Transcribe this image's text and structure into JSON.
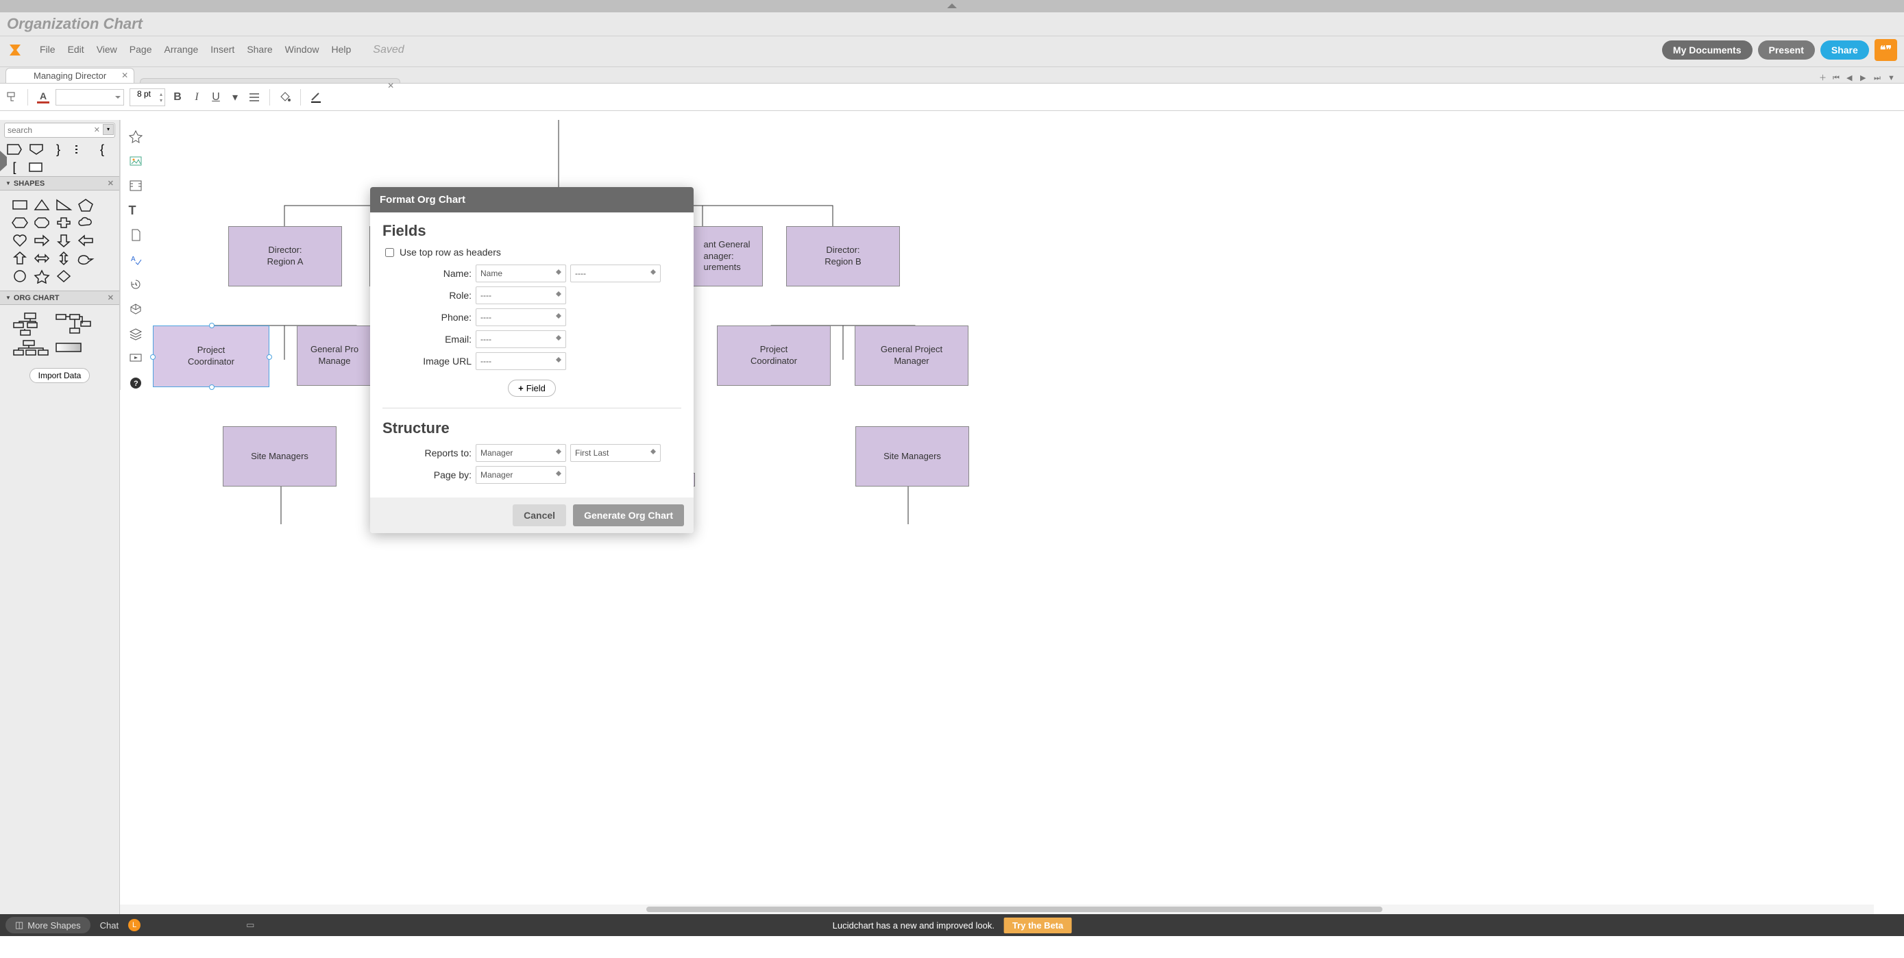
{
  "doc_title": "Organization Chart",
  "menus": [
    "File",
    "Edit",
    "View",
    "Page",
    "Arrange",
    "Insert",
    "Share",
    "Window",
    "Help"
  ],
  "saved": "Saved",
  "buttons": {
    "my_docs": "My Documents",
    "present": "Present",
    "share": "Share",
    "quote": "❝❞"
  },
  "tabs": {
    "tab1": "Managing Director",
    "tab2": ""
  },
  "toolbar": {
    "font_size": "8 pt"
  },
  "sidebar": {
    "search_placeholder": "search",
    "section_shapes": "SHAPES",
    "section_org": "ORG CHART",
    "import": "Import Data"
  },
  "chart_nodes": {
    "dir_a": "Director:\nRegion A",
    "dir_b": "Director:\nRegion B",
    "asst_gm": "ant General\nanager:\nurements",
    "pc1": "Project\nCoordinator",
    "gpm1": "General Pro\nManage",
    "pc2": "Project\nCoordinator",
    "gpm2": "General Project\nManager",
    "sm1": "Site Managers",
    "sm2": "Site Managers"
  },
  "dialog": {
    "title": "Format Org Chart",
    "fields_heading": "Fields",
    "use_headers": "Use top row as headers",
    "name": "Name:",
    "name_val": "Name",
    "name2_val": "----",
    "role": "Role:",
    "role_val": "----",
    "phone": "Phone:",
    "phone_val": "----",
    "email": "Email:",
    "email_val": "----",
    "image": "Image URL",
    "image_val": "----",
    "add_field": "Field",
    "structure_heading": "Structure",
    "reports_to": "Reports to:",
    "reports_val": "Manager",
    "reports2_val": "First Last",
    "page_by": "Page by:",
    "page_val": "Manager",
    "cancel": "Cancel",
    "generate": "Generate Org Chart"
  },
  "bottom": {
    "more_shapes": "More Shapes",
    "chat": "Chat",
    "chat_initial": "L",
    "banner": "Lucidchart has a new and improved look.",
    "beta": "Try the Beta"
  }
}
